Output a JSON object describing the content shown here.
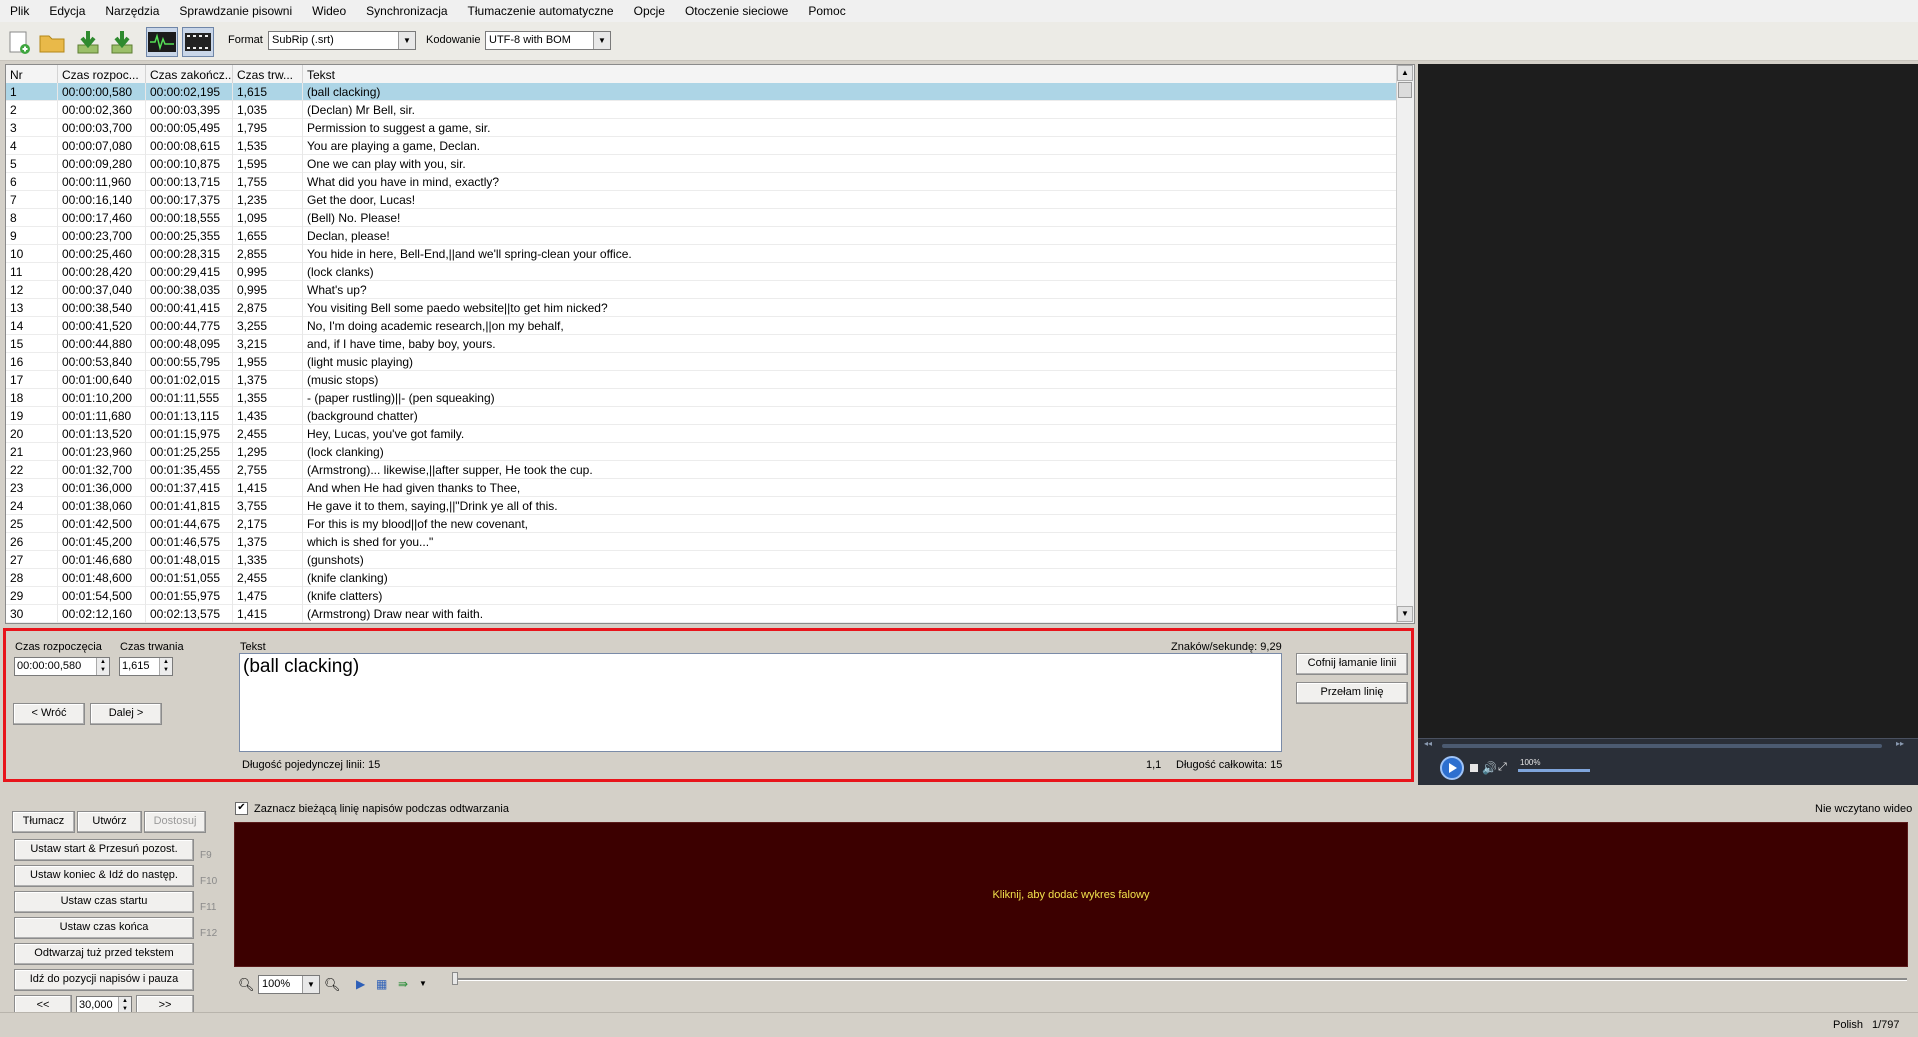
{
  "menu": [
    "Plik",
    "Edycja",
    "Narzędzia",
    "Sprawdzanie pisowni",
    "Wideo",
    "Synchronizacja",
    "Tłumaczenie automatyczne",
    "Opcje",
    "Otoczenie sieciowe",
    "Pomoc"
  ],
  "toolbar": {
    "format_label": "Format",
    "format_value": "SubRip (.srt)",
    "encoding_label": "Kodowanie",
    "encoding_value": "UTF-8 with BOM"
  },
  "grid": {
    "headers": [
      "Nr",
      "Czas rozpoc...",
      "Czas zakończ...",
      "Czas trw...",
      "Tekst"
    ],
    "rows": [
      [
        "1",
        "00:00:00,580",
        "00:00:02,195",
        "1,615",
        "(ball clacking)"
      ],
      [
        "2",
        "00:00:02,360",
        "00:00:03,395",
        "1,035",
        "(Declan) Mr Bell, sir."
      ],
      [
        "3",
        "00:00:03,700",
        "00:00:05,495",
        "1,795",
        "Permission to suggest a game, sir."
      ],
      [
        "4",
        "00:00:07,080",
        "00:00:08,615",
        "1,535",
        "You are playing a game, Declan."
      ],
      [
        "5",
        "00:00:09,280",
        "00:00:10,875",
        "1,595",
        "One we can play with you, sir."
      ],
      [
        "6",
        "00:00:11,960",
        "00:00:13,715",
        "1,755",
        "What did you have in mind, exactly?"
      ],
      [
        "7",
        "00:00:16,140",
        "00:00:17,375",
        "1,235",
        "Get the door, Lucas!"
      ],
      [
        "8",
        "00:00:17,460",
        "00:00:18,555",
        "1,095",
        "(Bell) No. Please!"
      ],
      [
        "9",
        "00:00:23,700",
        "00:00:25,355",
        "1,655",
        "Declan, please!"
      ],
      [
        "10",
        "00:00:25,460",
        "00:00:28,315",
        "2,855",
        "You hide in here, Bell-End,||and we'll spring-clean your office."
      ],
      [
        "11",
        "00:00:28,420",
        "00:00:29,415",
        "0,995",
        "(lock clanks)"
      ],
      [
        "12",
        "00:00:37,040",
        "00:00:38,035",
        "0,995",
        "What's up?"
      ],
      [
        "13",
        "00:00:38,540",
        "00:00:41,415",
        "2,875",
        "You visiting Bell some paedo website||to get him nicked?"
      ],
      [
        "14",
        "00:00:41,520",
        "00:00:44,775",
        "3,255",
        "No, I'm doing academic research,||on my behalf,"
      ],
      [
        "15",
        "00:00:44,880",
        "00:00:48,095",
        "3,215",
        "and, if I have time, baby boy, yours."
      ],
      [
        "16",
        "00:00:53,840",
        "00:00:55,795",
        "1,955",
        "(light music playing)"
      ],
      [
        "17",
        "00:01:00,640",
        "00:01:02,015",
        "1,375",
        "(music stops)"
      ],
      [
        "18",
        "00:01:10,200",
        "00:01:11,555",
        "1,355",
        "- (paper rustling)||- (pen squeaking)"
      ],
      [
        "19",
        "00:01:11,680",
        "00:01:13,115",
        "1,435",
        "(background chatter)"
      ],
      [
        "20",
        "00:01:13,520",
        "00:01:15,975",
        "2,455",
        "Hey, Lucas, you've got family."
      ],
      [
        "21",
        "00:01:23,960",
        "00:01:25,255",
        "1,295",
        "(lock clanking)"
      ],
      [
        "22",
        "00:01:32,700",
        "00:01:35,455",
        "2,755",
        "(Armstrong)... likewise,||after supper, He took the cup."
      ],
      [
        "23",
        "00:01:36,000",
        "00:01:37,415",
        "1,415",
        "And when He had given thanks to Thee,"
      ],
      [
        "24",
        "00:01:38,060",
        "00:01:41,815",
        "3,755",
        "He gave it to them, saying,||\"Drink ye all of this."
      ],
      [
        "25",
        "00:01:42,500",
        "00:01:44,675",
        "2,175",
        "For this is my blood||of the new covenant,"
      ],
      [
        "26",
        "00:01:45,200",
        "00:01:46,575",
        "1,375",
        "which is shed for you...\""
      ],
      [
        "27",
        "00:01:46,680",
        "00:01:48,015",
        "1,335",
        "(gunshots)"
      ],
      [
        "28",
        "00:01:48,600",
        "00:01:51,055",
        "2,455",
        "(knife clanking)"
      ],
      [
        "29",
        "00:01:54,500",
        "00:01:55,975",
        "1,475",
        "(knife clatters)"
      ],
      [
        "30",
        "00:02:12,160",
        "00:02:13,575",
        "1,415",
        "(Armstrong) Draw near with faith."
      ]
    ]
  },
  "edit": {
    "start_label": "Czas rozpoczęcia",
    "start_value": "00:00:00,580",
    "duration_label": "Czas trwania",
    "duration_value": "1,615",
    "text_label": "Tekst",
    "cps": "Znaków/sekundę: 9,29",
    "text_value": "(ball clacking)",
    "prev": "< Wróć",
    "next": "Dalej >",
    "undo_linebreak": "Cofnij łamanie linii",
    "break_line": "Przełam linię",
    "single_line_length": "Długość pojedynczej linii: 15",
    "position": "1,1",
    "total_length": "Długość całkowita: 15"
  },
  "video": {
    "volume": "100%"
  },
  "lower": {
    "tab_translate": "Tłumacz",
    "tab_create": "Utwórz",
    "tab_adjust": "Dostosuj",
    "btn1": "Ustaw start & Przesuń pozost.",
    "btn2": "Ustaw koniec & Idź do następ.",
    "btn3": "Ustaw czas startu",
    "btn4": "Ustaw czas końca",
    "btn5": "Odtwarzaj tuż przed tekstem",
    "btn6": "Idź do pozycji napisów i pauza",
    "f9": "F9",
    "f10": "F10",
    "f11": "F11",
    "f12": "F12",
    "seek_back": "<<",
    "seek_value": "30,000",
    "seek_fwd": ">>",
    "checkbox_label": "Zaznacz bieżącą linię napisów podczas odtwarzania",
    "checkbox_mark": "✔",
    "no_video": "Nie wczytano wideo",
    "waveform_msg": "Kliknij, aby dodać wykres falowy",
    "zoom": "100%"
  },
  "status": {
    "language": "Polish",
    "position": "1/797"
  },
  "colors": {
    "selection": "#add5e6",
    "highlight_border": "#e8141b",
    "waveform_bg": "#3c0000",
    "waveform_text": "#f2e14b"
  }
}
